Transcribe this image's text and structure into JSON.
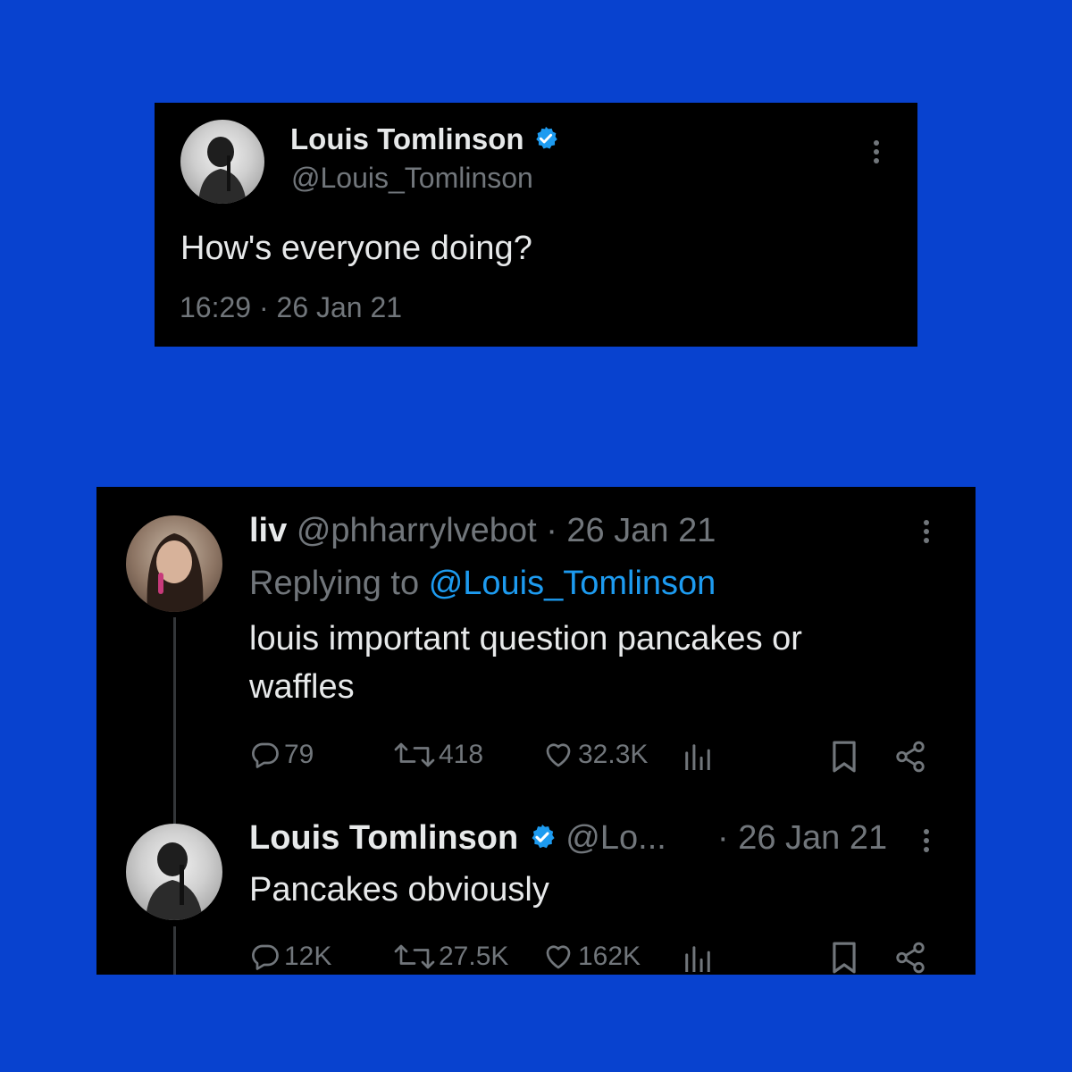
{
  "original_tweet": {
    "author_name": "Louis Tomlinson",
    "author_handle": "@Louis_Tomlinson",
    "text": "How's everyone doing?",
    "timestamp": "16:29 · 26 Jan 21",
    "verified_icon": "verified-badge-icon",
    "more_icon": "more-options-icon"
  },
  "reply": {
    "author_name": "liv",
    "author_handle": "@phharrylvebot",
    "separator_date": "· 26 Jan 21",
    "replying_prefix": "Replying to",
    "replying_handle": "@Louis_Tomlinson",
    "text_line1": "louis important question pancakes or",
    "text_line2": "waffles",
    "actions": {
      "replies": "79",
      "retweets": "418",
      "likes": "32.3K"
    }
  },
  "answer": {
    "author_name": "Louis Tomlinson",
    "author_handle": "@Lo...",
    "separator_date": "· 26 Jan 21",
    "text": "Pancakes obviously",
    "actions": {
      "replies": "12K",
      "retweets": "27.5K",
      "likes": "162K"
    }
  },
  "colors": {
    "background": "#0842cf",
    "card": "#000000",
    "primary_text": "#e7e9ea",
    "secondary_text": "#71767b",
    "accent": "#1d9bf0"
  }
}
